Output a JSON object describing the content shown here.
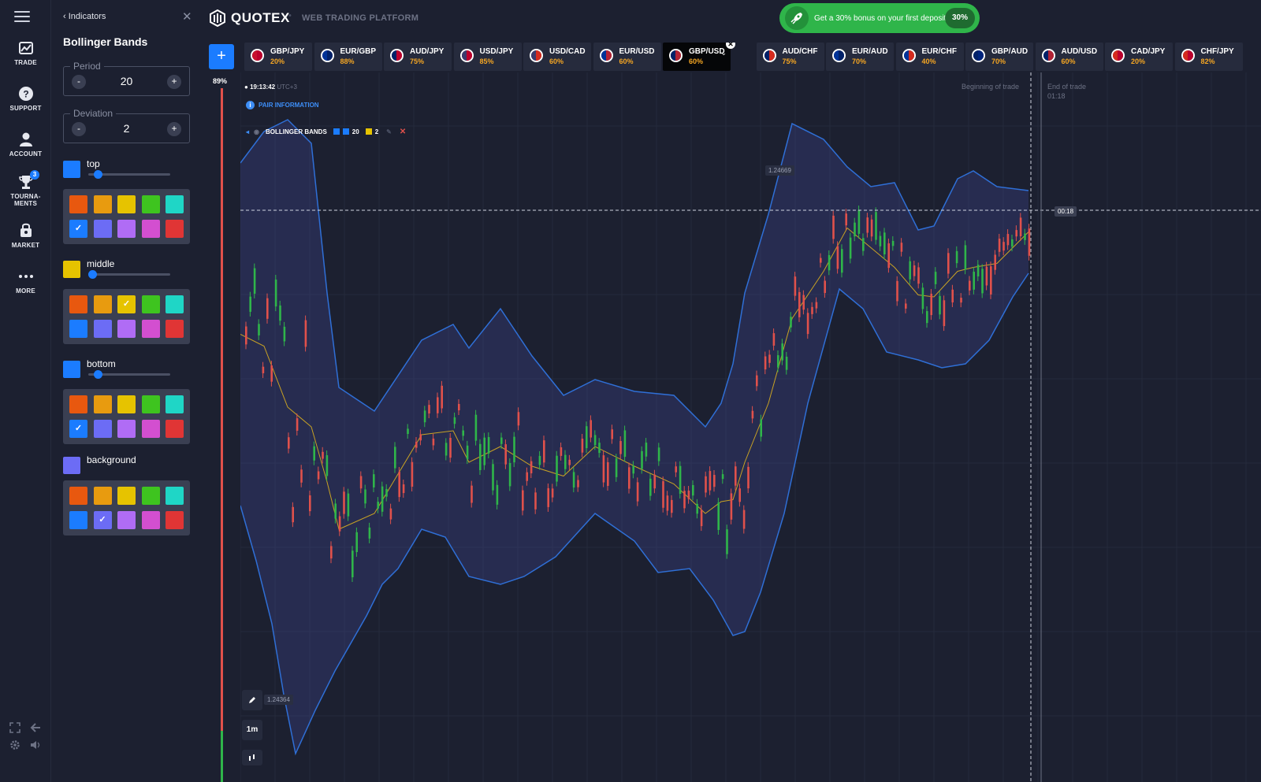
{
  "nav": {
    "items": [
      {
        "label": "TRADE",
        "icon": "chart-icon"
      },
      {
        "label": "SUPPORT",
        "icon": "question-icon"
      },
      {
        "label": "ACCOUNT",
        "icon": "user-icon"
      },
      {
        "label": "TOURNA-\nMENTS",
        "icon": "trophy-icon",
        "badge": "3"
      },
      {
        "label": "MARKET",
        "icon": "market-icon"
      },
      {
        "label": "MORE",
        "icon": "more-icon"
      }
    ]
  },
  "panel": {
    "back_label": "Indicators",
    "title": "Bollinger Bands",
    "period": {
      "legend": "Period",
      "value": "20",
      "minus": "-",
      "plus": "+"
    },
    "deviation": {
      "legend": "Deviation",
      "value": "2",
      "minus": "-",
      "plus": "+"
    },
    "top": {
      "label": "top",
      "color": "#1b7cff",
      "slider": 0.08
    },
    "middle": {
      "label": "middle",
      "color": "#e6c300",
      "slider": 0.0
    },
    "bottom": {
      "label": "bottom",
      "color": "#1b7cff",
      "slider": 0.08
    },
    "background": {
      "label": "background",
      "color": "#6c6cf5"
    },
    "palette_colors": [
      "#e8580f",
      "#e89b0f",
      "#e6c300",
      "#3ec41f",
      "#1fd6c6",
      "#1b7cff",
      "#6c6cf5",
      "#b06cf5",
      "#d34fd0",
      "#e03535"
    ]
  },
  "header": {
    "logo": "QUOTEX",
    "platform": "WEB TRADING PLATFORM",
    "promo_text": "Get a 30% bonus on your first deposit",
    "promo_pct": "30%"
  },
  "tabs": [
    {
      "pair": "GBP/JPY",
      "payout": "20%",
      "c1": "#c8102e",
      "c2": "#bc002d"
    },
    {
      "pair": "EUR/GBP",
      "payout": "88%",
      "c1": "#003399",
      "c2": "#012169"
    },
    {
      "pair": "AUD/JPY",
      "payout": "75%",
      "c1": "#012169",
      "c2": "#bc002d"
    },
    {
      "pair": "USD/JPY",
      "payout": "85%",
      "c1": "#3c3b6e",
      "c2": "#bc002d"
    },
    {
      "pair": "USD/CAD",
      "payout": "60%",
      "c1": "#3c3b6e",
      "c2": "#d52b1e"
    },
    {
      "pair": "EUR/USD",
      "payout": "60%",
      "c1": "#003399",
      "c2": "#b22234"
    },
    {
      "pair": "GBP/USD",
      "payout": "60%",
      "c1": "#012169",
      "c2": "#b22234",
      "active": true
    },
    {
      "pair": "AUD/CHF",
      "payout": "75%",
      "c1": "#012169",
      "c2": "#d52b1e"
    },
    {
      "pair": "EUR/AUD",
      "payout": "70%",
      "c1": "#003399",
      "c2": "#012169"
    },
    {
      "pair": "EUR/CHF",
      "payout": "40%",
      "c1": "#003399",
      "c2": "#d52b1e"
    },
    {
      "pair": "GBP/AUD",
      "payout": "70%",
      "c1": "#012169",
      "c2": "#00247d"
    },
    {
      "pair": "AUD/USD",
      "payout": "60%",
      "c1": "#012169",
      "c2": "#b22234"
    },
    {
      "pair": "CAD/JPY",
      "payout": "20%",
      "c1": "#d52b1e",
      "c2": "#bc002d"
    },
    {
      "pair": "CHF/JPY",
      "payout": "82%",
      "c1": "#d52b1e",
      "c2": "#bc002d"
    }
  ],
  "chart": {
    "progress": "89%",
    "time": "19:13:42",
    "timezone": "UTC+3",
    "pair_info": "PAIR INFORMATION",
    "indicator_label": "BOLLINGER BANDS",
    "indicator_period": "20",
    "indicator_dev": "2",
    "price_high": "1.24669",
    "price_low": "1.24364",
    "timer": "00:18",
    "begin_trade": "Beginning of trade",
    "end_trade": "End of trade",
    "end_time": "01:18",
    "timeframe": "1m",
    "colors": {
      "band": "#2f6fd6",
      "mid": "#c8a224",
      "up": "#2fb54a",
      "down": "#e0514b",
      "fill": "rgba(60,70,140,0.35)"
    }
  }
}
